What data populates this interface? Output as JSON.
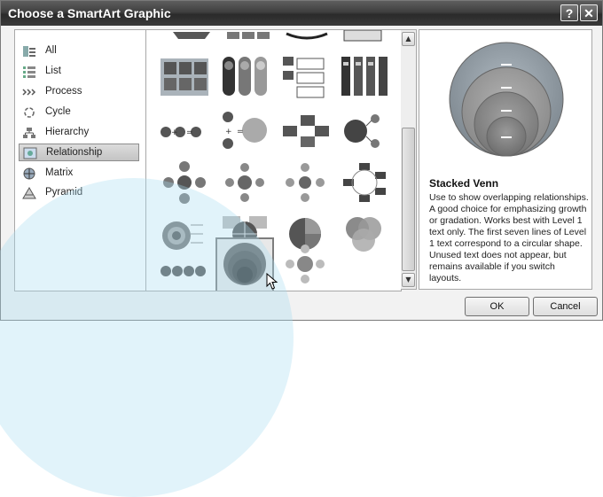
{
  "window": {
    "title": "Choose a SmartArt Graphic"
  },
  "titlebar": {
    "help_label": "?",
    "close_label": "✕"
  },
  "categories": [
    {
      "label": "All",
      "icon": "all-icon"
    },
    {
      "label": "List",
      "icon": "list-icon"
    },
    {
      "label": "Process",
      "icon": "process-icon"
    },
    {
      "label": "Cycle",
      "icon": "cycle-icon"
    },
    {
      "label": "Hierarchy",
      "icon": "hierarchy-icon"
    },
    {
      "label": "Relationship",
      "icon": "relationship-icon",
      "selected": true
    },
    {
      "label": "Matrix",
      "icon": "matrix-icon"
    },
    {
      "label": "Pyramid",
      "icon": "pyramid-icon"
    }
  ],
  "preview": {
    "title": "Stacked Venn",
    "description": "Use to show overlapping relationships. A good choice for emphasizing growth or gradation. Works best with Level 1 text only. The first seven lines of Level 1 text correspond to a circular shape. Unused text does not appear, but remains available if you switch layouts."
  },
  "buttons": {
    "ok": "OK",
    "cancel": "Cancel"
  },
  "colors": {
    "titlebar": "#3a3a3a",
    "selection": "#c8c8c8"
  }
}
